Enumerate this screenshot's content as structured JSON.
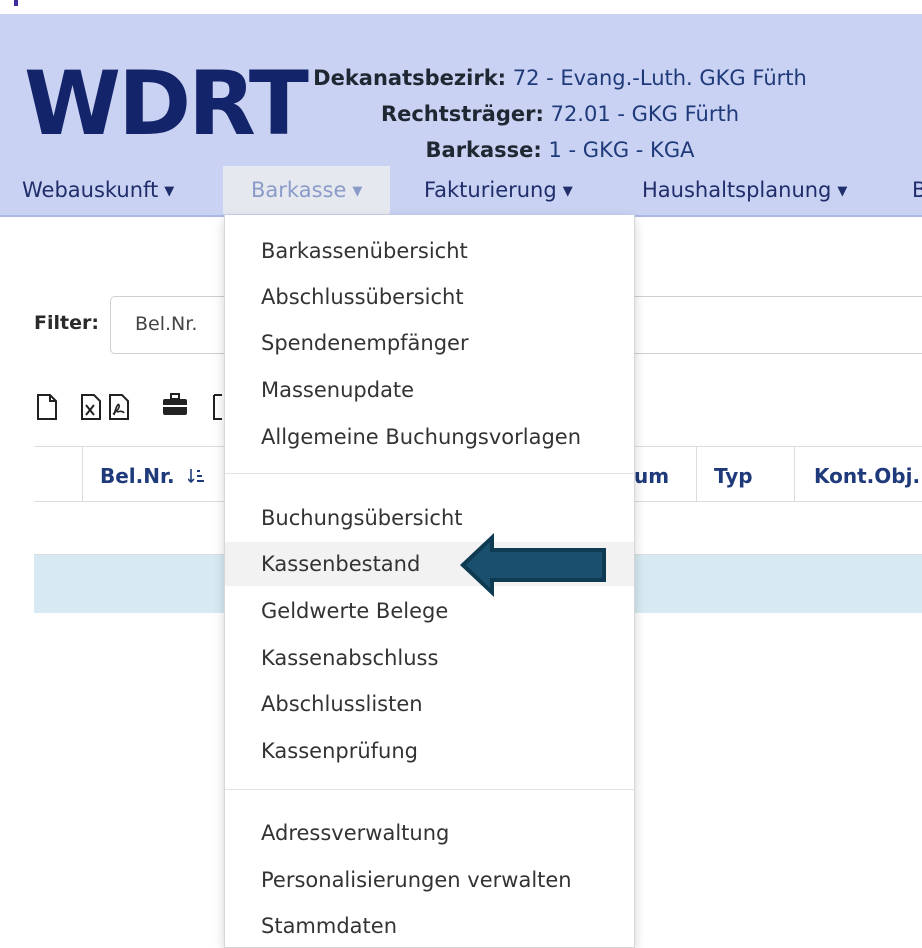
{
  "app": {
    "logo": "WDRT"
  },
  "header_info": [
    {
      "label": "Dekanatsbezirk:",
      "value": "72 - Evang.-Luth. GKG Fürth"
    },
    {
      "label": "Rechtsträger:",
      "value": "72.01 - GKG Fürth"
    },
    {
      "label": "Barkasse:",
      "value": "1 - GKG - KGA"
    }
  ],
  "nav": [
    {
      "label": "Webauskunft"
    },
    {
      "label": "Barkasse"
    },
    {
      "label": "Fakturierung"
    },
    {
      "label": "Haushaltsplanung"
    },
    {
      "label": "B"
    }
  ],
  "filter": {
    "label": "Filter:",
    "value": "Bel.Nr."
  },
  "table": {
    "headers": [
      "Bel.Nr.",
      "um",
      "Typ",
      "Kont.Obj."
    ]
  },
  "dropdown": {
    "group1": [
      "Barkassenübersicht",
      "Abschlussübersicht",
      "Spendenempfänger",
      "Massenupdate",
      "Allgemeine Buchungsvorlagen"
    ],
    "group2": [
      "Buchungsübersicht",
      "Kassenbestand",
      "Geldwerte Belege",
      "Kassenabschluss",
      "Abschlusslisten",
      "Kassenprüfung"
    ],
    "group3": [
      "Adressverwaltung",
      "Personalisierungen verwalten",
      "Stammdaten"
    ],
    "highlighted": "Kassenbestand"
  },
  "colors": {
    "header_bg": "#c9d2f2",
    "logo": "#14246b",
    "info_value": "#1f3a7a",
    "arrow_fill": "#1b4f6e",
    "highlight_row": "#d7eaf3"
  }
}
